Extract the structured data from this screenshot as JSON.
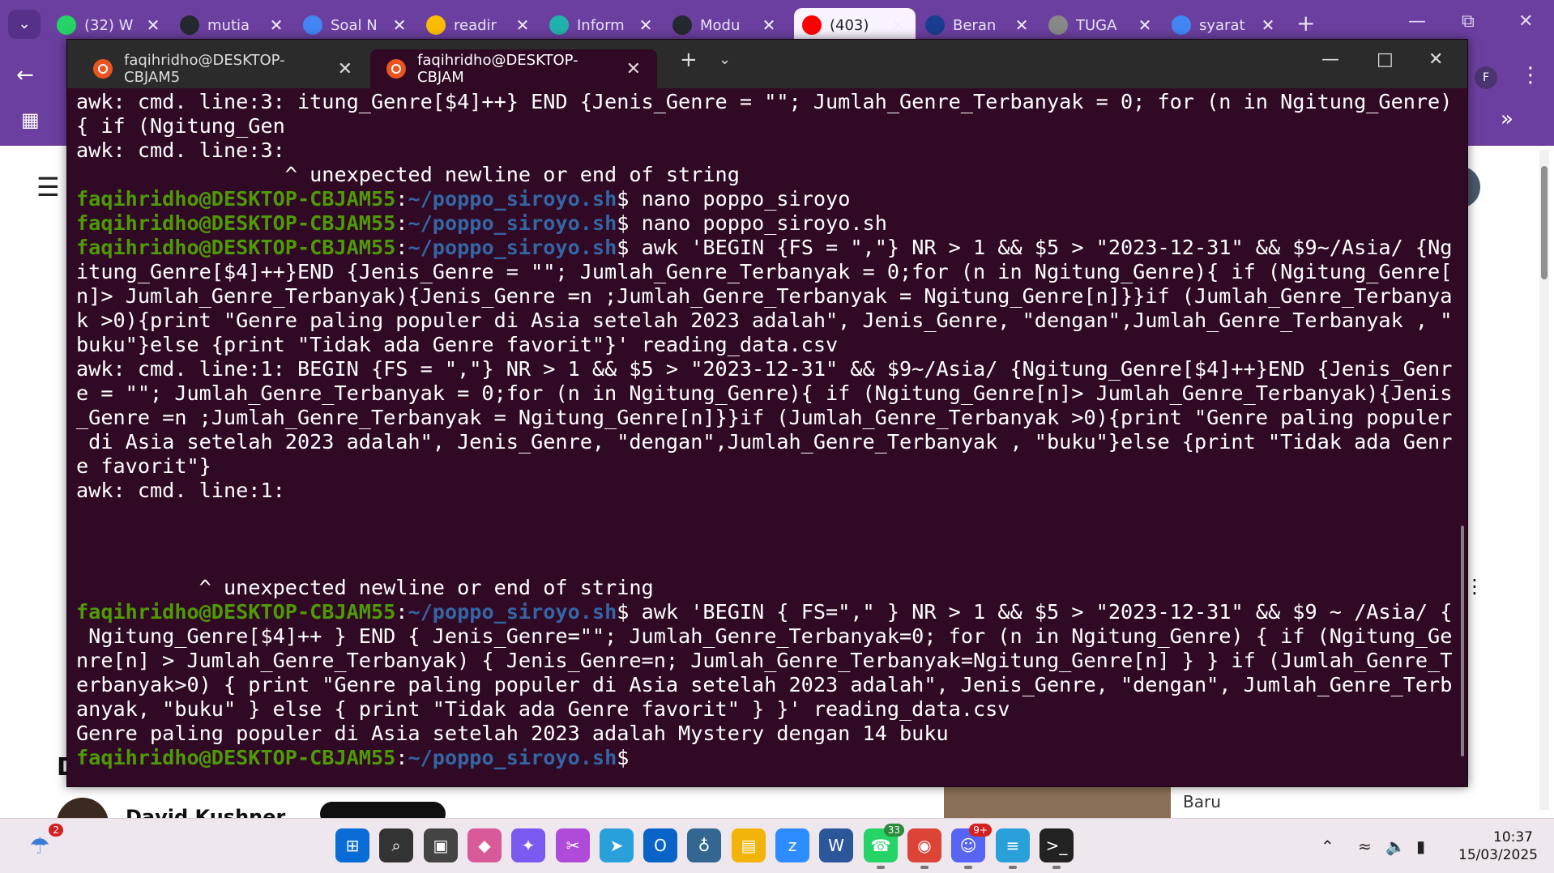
{
  "chrome": {
    "tabs": [
      {
        "label": "(32) W",
        "icon": "whatsapp-icon",
        "color": "#25d366"
      },
      {
        "label": "mutia",
        "icon": "github-icon",
        "color": "#24292f"
      },
      {
        "label": "Soal N",
        "icon": "docs-icon",
        "color": "#4285f4"
      },
      {
        "label": "readir",
        "icon": "drive-icon",
        "color": "#fbbc04"
      },
      {
        "label": "Inform",
        "icon": "perplexity-icon",
        "color": "#20b2aa"
      },
      {
        "label": "Modu",
        "icon": "github-icon",
        "color": "#24292f"
      },
      {
        "label": "(403)",
        "icon": "youtube-icon",
        "color": "#ff0000"
      },
      {
        "label": "Beran",
        "icon": "its-icon",
        "color": "#1a3d8f"
      },
      {
        "label": "TUGA",
        "icon": "globe-icon",
        "color": "#888888"
      },
      {
        "label": "syarat",
        "icon": "google-icon",
        "color": "#4285f4"
      }
    ]
  },
  "terminal": {
    "tabs": [
      {
        "label": "faqihridho@DESKTOP-CBJAM5"
      },
      {
        "label": "faqihridho@DESKTOP-CBJAM"
      }
    ],
    "lines": [
      {
        "t": "awk: cmd. line:3: itung_Genre[$4]++} END {Jenis_Genre = \"\"; Jumlah_Genre_Terbanyak = 0; for (n in Ngitung_Genre)"
      },
      {
        "t": "{ if (Ngitung_Gen"
      },
      {
        "t": "awk: cmd. line:3:"
      },
      {
        "t": "                 ^ unexpected newline or end of string"
      },
      {
        "p": true,
        "u": "faqihridho@DESKTOP-CBJAM55",
        "d": "~/poppo_siroyo.sh",
        "c": "$ nano poppo_siroyo"
      },
      {
        "p": true,
        "u": "faqihridho@DESKTOP-CBJAM55",
        "d": "~/poppo_siroyo.sh",
        "c": "$ nano poppo_siroyo.sh"
      },
      {
        "p": true,
        "u": "faqihridho@DESKTOP-CBJAM55",
        "d": "~/poppo_siroyo.sh",
        "c": "$ awk 'BEGIN {FS = \",\"} NR > 1 && $5 > \"2023-12-31\" && $9~/Asia/ {Ng"
      },
      {
        "t": "itung_Genre[$4]++}END {Jenis_Genre = \"\"; Jumlah_Genre_Terbanyak = 0;for (n in Ngitung_Genre){ if (Ngitung_Genre["
      },
      {
        "t": "n]> Jumlah_Genre_Terbanyak){Jenis_Genre =n ;Jumlah_Genre_Terbanyak = Ngitung_Genre[n]}}if (Jumlah_Genre_Terbanya"
      },
      {
        "t": "k >0){print \"Genre paling populer di Asia setelah 2023 adalah\", Jenis_Genre, \"dengan\",Jumlah_Genre_Terbanyak , \""
      },
      {
        "t": "buku\"}else {print \"Tidak ada Genre favorit\"}' reading_data.csv"
      },
      {
        "t": "awk: cmd. line:1: BEGIN {FS = \",\"} NR > 1 && $5 > \"2023-12-31\" && $9~/Asia/ {Ngitung_Genre[$4]++}END {Jenis_Genr"
      },
      {
        "t": "e = \"\"; Jumlah_Genre_Terbanyak = 0;for (n in Ngitung_Genre){ if (Ngitung_Genre[n]> Jumlah_Genre_Terbanyak){Jenis"
      },
      {
        "t": "_Genre =n ;Jumlah_Genre_Terbanyak = Ngitung_Genre[n]}}if (Jumlah_Genre_Terbanyak >0){print \"Genre paling populer"
      },
      {
        "t": " di Asia setelah 2023 adalah\", Jenis_Genre, \"dengan\",Jumlah_Genre_Terbanyak , \"buku\"}else {print \"Tidak ada Genr"
      },
      {
        "t": "e favorit\"}"
      },
      {
        "t": "awk: cmd. line:1:"
      },
      {
        "t": ""
      },
      {
        "t": ""
      },
      {
        "t": ""
      },
      {
        "t": "          ^ unexpected newline or end of string"
      },
      {
        "p": true,
        "u": "faqihridho@DESKTOP-CBJAM55",
        "d": "~/poppo_siroyo.sh",
        "c": "$ awk 'BEGIN { FS=\",\" } NR > 1 && $5 > \"2023-12-31\" && $9 ~ /Asia/ {"
      },
      {
        "t": " Ngitung_Genre[$4]++ } END { Jenis_Genre=\"\"; Jumlah_Genre_Terbanyak=0; for (n in Ngitung_Genre) { if (Ngitung_Ge"
      },
      {
        "t": "nre[n] > Jumlah_Genre_Terbanyak) { Jenis_Genre=n; Jumlah_Genre_Terbanyak=Ngitung_Genre[n] } } if (Jumlah_Genre_T"
      },
      {
        "t": "erbanyak>0) { print \"Genre paling populer di Asia setelah 2023 adalah\", Jenis_Genre, \"dengan\", Jumlah_Genre_Terb"
      },
      {
        "t": "anyak, \"buku\" } else { print \"Tidak ada Genre favorit\" } }' reading_data.csv"
      },
      {
        "t": "Genre paling populer di Asia setelah 2023 adalah Mystery dengan 14 buku"
      },
      {
        "p": true,
        "u": "faqihridho@DESKTOP-CBJAM55",
        "d": "~/poppo_siroyo.sh",
        "c": "$ "
      }
    ]
  },
  "background": {
    "avatar_letter": "F",
    "profile_letter": "F",
    "channel_name": "David Kushner",
    "badge": "Baru",
    "partial_letter": "D"
  },
  "taskbar": {
    "weather_badge": "2",
    "whatsapp_badge": "33",
    "discord_badge": "9+",
    "time": "10:37",
    "date": "15/03/2025",
    "apps": [
      "start-icon",
      "search-icon",
      "task-view-icon",
      "paint-icon",
      "copilot-icon",
      "snipping-icon",
      "telegram-icon",
      "outlook-icon",
      "postgres-icon",
      "file-explorer-icon",
      "zoom-icon",
      "word-icon",
      "whatsapp-icon",
      "chrome-icon",
      "discord-icon",
      "notepad-icon",
      "terminal-icon"
    ]
  }
}
